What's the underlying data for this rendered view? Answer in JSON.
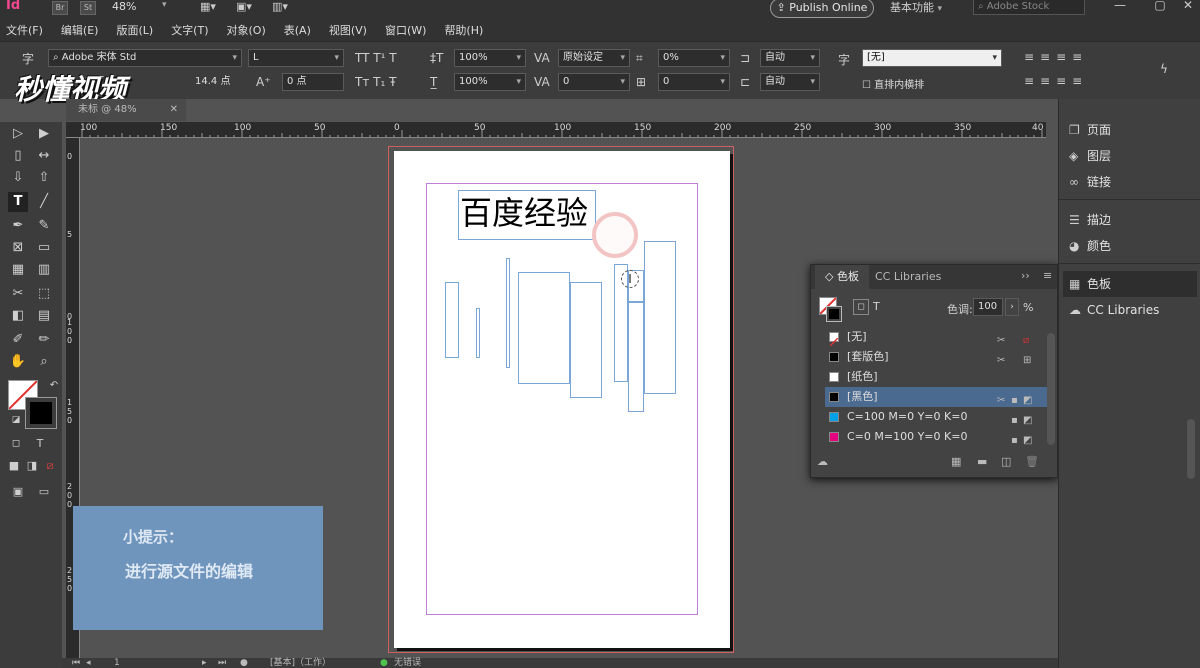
{
  "app": {
    "logo": "Id",
    "bridge_badge": "Br",
    "stock_badge": "St",
    "zoom": "48%",
    "publish_label": "Publish Online",
    "workspace": "基本功能",
    "stock_placeholder": "Adobe Stock"
  },
  "menu": [
    "文件(F)",
    "编辑(E)",
    "版面(L)",
    "文字(T)",
    "对象(O)",
    "表(A)",
    "视图(V)",
    "窗口(W)",
    "帮助(H)"
  ],
  "control": {
    "font_family": "Adobe 宋体 Std",
    "font_style": "L",
    "font_size": "2 点",
    "leading": "14.4 点",
    "kerning_label": "原始设定",
    "tracking": "0",
    "vscale": "100%",
    "hscale": "100%",
    "baseline": "0 点",
    "skew": "0",
    "tsume": "0%",
    "charrot": "0",
    "aki_before": "自动",
    "aki_after": "自动",
    "char_style": "[无]",
    "tate_chu_yoko_label": "直排内横排"
  },
  "watermark": "秒懂视频",
  "document_tab": "未标 @ 48%",
  "ruler": {
    "h_labels": [
      "100",
      "150",
      "100",
      "50",
      "0",
      "50",
      "100",
      "150",
      "200",
      "250",
      "300",
      "350",
      "40"
    ],
    "v_labels": [
      "0",
      "5",
      "0",
      "1\n0\n0",
      "1\n5\n0",
      "2\n0\n0",
      "2\n5\n0"
    ]
  },
  "page": {
    "title_text": "百度经验"
  },
  "tip": {
    "title": "小提示：",
    "body": "进行源文件的编辑"
  },
  "swatches": {
    "tab_active": "色板",
    "tab_other": "CC Libraries",
    "tint_label": "色调:",
    "tint_value": "100",
    "tint_unit": "%",
    "rows": [
      {
        "name": "[无]",
        "color": "none"
      },
      {
        "name": "[套版色]",
        "color": "#000000"
      },
      {
        "name": "[纸色]",
        "color": "#ffffff"
      },
      {
        "name": "[黑色]",
        "color": "#000000",
        "selected": true
      },
      {
        "name": "C=100 M=0 Y=0 K=0",
        "color": "#00a0e8"
      },
      {
        "name": "C=0 M=100 Y=0 K=0",
        "color": "#e4007f"
      }
    ]
  },
  "dock": {
    "items": [
      "页面",
      "图层",
      "链接",
      "描边",
      "颜色",
      "色板",
      "CC Libraries"
    ]
  },
  "status": {
    "page_number": "1",
    "master": "[基本]（工作）",
    "preflight": "无错误"
  }
}
